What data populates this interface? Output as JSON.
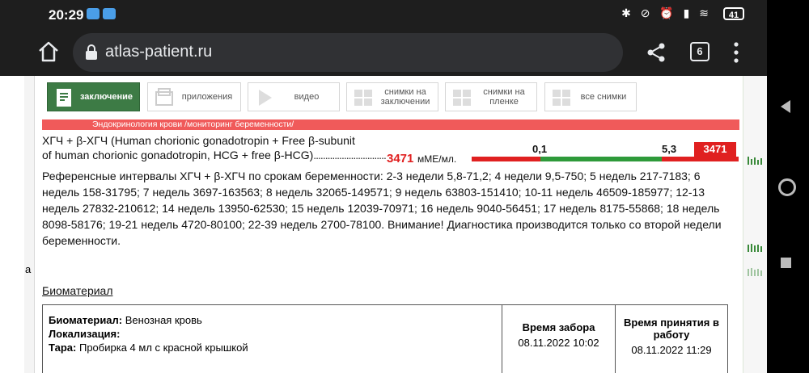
{
  "status_bar": {
    "time": "20:29",
    "battery": "41"
  },
  "browser": {
    "url": "atlas-patient.ru",
    "tab_count": "6"
  },
  "tabs": [
    {
      "label": "заключение",
      "icon": "document-icon"
    },
    {
      "label": "приложения",
      "icon": "attachment-icon"
    },
    {
      "label": "видео",
      "icon": "play-icon"
    },
    {
      "label": "снимки на заключении",
      "icon": "images-icon"
    },
    {
      "label": "снимки на пленке",
      "icon": "film-icon"
    },
    {
      "label": "все снимки",
      "icon": "gallery-icon"
    }
  ],
  "section": {
    "title": "Эндокринология крови /мониторинг беременности/"
  },
  "test": {
    "name_line1": "ХГЧ + β-ХГЧ (Human chorionic gonadotropin + Free β-subunit",
    "name_line2": "of human chorionic gonadotropin, HCG + free β-HCG)",
    "dots": "...............................",
    "value": "3471",
    "unit": "мМЕ/мл.",
    "scale_low": "0,1",
    "scale_high": "5,3",
    "flag_value": "3471"
  },
  "reference_text": "Референсные интервалы ХГЧ + β-ХГЧ по срокам беременности: 2-3 недели 5,8-71,2; 4 недели 9,5-750; 5 недель 217-7183; 6 недель 158-31795; 7 недель 3697-163563; 8 недель 32065-149571; 9 недель 63803-151410; 10-11 недель 46509-185977; 12-13 недель 27832-210612; 14 недель 13950-62530; 15 недель 12039-70971; 16 недель 9040-56451; 17 недель 8175-55868; 18 недель 8098-58176; 19-21 недель 4720-80100; 22-39 недель 2700-78100. Внимание! Диагностика производится только со второй недели беременности.",
  "biomaterial": {
    "link": "Биоматериал",
    "material_label": "Биоматериал:",
    "material_value": "Венозная кровь",
    "location_label": "Локализация:",
    "location_value": "",
    "container_label": "Тара:",
    "container_value": "Пробирка 4 мл с красной крышкой",
    "collect_header": "Время забора",
    "collect_time": "08.11.2022 10:02",
    "accept_header": "Время принятия в работу",
    "accept_time": "08.11.2022 11:29"
  },
  "left_strip_letter": "а",
  "colors": {
    "accent_green": "#3d7b45",
    "alert_red": "#e02020",
    "section_red": "#f05a5a"
  }
}
